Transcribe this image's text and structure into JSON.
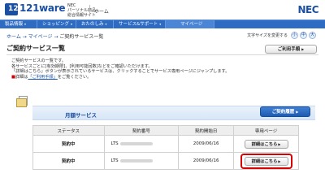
{
  "header": {
    "logo_mark": "121",
    "logo_text": "121ware",
    "logo_sub": [
      "NEC",
      "パーソナル商品",
      "総合情報サイト"
    ],
    "home_label": "ホーム",
    "nec_logo": "NEC"
  },
  "nav": {
    "items": [
      {
        "label": "製品情報"
      },
      {
        "label": "ショッピング"
      },
      {
        "label": "おたのしみ"
      },
      {
        "label": "サービス&サポート"
      },
      {
        "label": "マイページ"
      }
    ],
    "chevron": "▾"
  },
  "breadcrumb": {
    "home": "ホーム",
    "sep1": " → ",
    "mypage": "マイページ",
    "sep2": " → ",
    "current": "ご契約サービス一覧"
  },
  "font_size": {
    "label": "文字サイズを変更する",
    "small": "小",
    "medium": "中",
    "large": "大"
  },
  "page": {
    "title": "ご契約サービス一覧",
    "guide_button": "ご利用手順"
  },
  "description": {
    "line1": "ご契約サービスの一覧です。",
    "line2": "各サービスごとに[有効期限]、[利用可能回数]などをご確認いただけます。",
    "line3": "「詳細はこちら」ボタンが表示されているサービスは、クリックすることでサービス専用ページにジャンプします。",
    "line4_mark": "■",
    "line4_pre": "詳細は",
    "line4_link": "「ご利用手順」",
    "line4_post": "をご覧ください。"
  },
  "monthly": {
    "title": "月額サービス",
    "history_button": "ご契約履歴"
  },
  "table": {
    "headers": {
      "status": "ステータス",
      "contract_no": "契約番号",
      "start_date": "契約開始日",
      "dedicated_page": "専用ページ"
    },
    "rows": [
      {
        "status": "契約中",
        "contract_prefix": "LTS",
        "start_date": "2009/06/16",
        "button": "詳細はこちら"
      },
      {
        "status": "契約中",
        "contract_prefix": "LTS",
        "start_date": "2009/06/16",
        "button": "詳細はこちら"
      }
    ]
  },
  "colors": {
    "brand_blue": "#1a4fa3",
    "nav_blue": "#2e6cc4",
    "highlight_red": "#d80000"
  }
}
